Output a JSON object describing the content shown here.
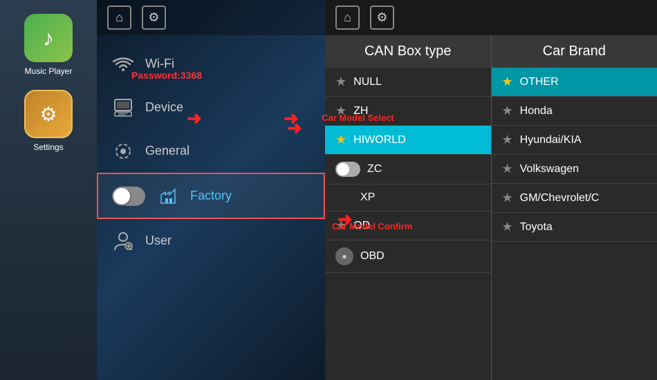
{
  "sidebar": {
    "apps": [
      {
        "id": "music-player",
        "label": "Music Player",
        "icon": "♪",
        "iconClass": "music"
      },
      {
        "id": "settings",
        "label": "Settings",
        "icon": "⚙",
        "iconClass": "settings"
      }
    ]
  },
  "menu": {
    "header": {
      "home_icon": "⌂",
      "gear_icon": "⚙"
    },
    "password_label": "Password:3368",
    "items": [
      {
        "id": "wifi",
        "icon": "wifi",
        "label": "Wi-Fi",
        "active": false
      },
      {
        "id": "device",
        "icon": "device",
        "label": "Device",
        "active": false
      },
      {
        "id": "general",
        "icon": "general",
        "label": "General",
        "active": false
      },
      {
        "id": "factory",
        "icon": "factory",
        "label": "Factory",
        "active": true
      },
      {
        "id": "user",
        "icon": "user",
        "label": "User",
        "active": false
      }
    ]
  },
  "right_panel": {
    "columns": [
      {
        "id": "can-box-type",
        "header": "CAN Box type",
        "items": [
          {
            "id": "null",
            "label": "NULL",
            "star": true,
            "starGold": false,
            "highlighted": false
          },
          {
            "id": "zh",
            "label": "ZH",
            "star": true,
            "starGold": false,
            "highlighted": false
          },
          {
            "id": "hiworld",
            "label": "HIWORLD",
            "star": true,
            "starGold": true,
            "highlighted": true
          },
          {
            "id": "zc",
            "label": "ZC",
            "star": false,
            "starGold": false,
            "highlighted": false,
            "confirmToggle": true
          },
          {
            "id": "xp",
            "label": "XP",
            "star": false,
            "starGold": false,
            "highlighted": false
          },
          {
            "id": "od",
            "label": "OD",
            "star": true,
            "starGold": false,
            "highlighted": false
          },
          {
            "id": "obd",
            "label": "OBD",
            "star": false,
            "starGold": false,
            "highlighted": false,
            "obdIcon": true
          }
        ]
      },
      {
        "id": "car-brand",
        "header": "Car Brand",
        "items": [
          {
            "id": "other",
            "label": "OTHER",
            "star": true,
            "starGold": true,
            "highlighted": true
          },
          {
            "id": "honda",
            "label": "Honda",
            "star": true,
            "starGold": false,
            "highlighted": false
          },
          {
            "id": "hyundai",
            "label": "Hyundai/KIA",
            "star": true,
            "starGold": false,
            "highlighted": false
          },
          {
            "id": "volkswagen",
            "label": "Volkswagen",
            "star": true,
            "starGold": false,
            "highlighted": false
          },
          {
            "id": "gm",
            "label": "GM/Chevrolet/C",
            "star": true,
            "starGold": false,
            "highlighted": false
          },
          {
            "id": "toyota",
            "label": "Toyota",
            "star": true,
            "starGold": false,
            "highlighted": false
          }
        ]
      }
    ],
    "labels": {
      "car_model_select": "Car Model Select",
      "car_model_confirm": "Car Model Confirm"
    }
  },
  "arrows": {
    "device_arrow1": "➜",
    "device_arrow2": "➜",
    "model_arrow": "➜",
    "confirm_arrow": "➜"
  }
}
